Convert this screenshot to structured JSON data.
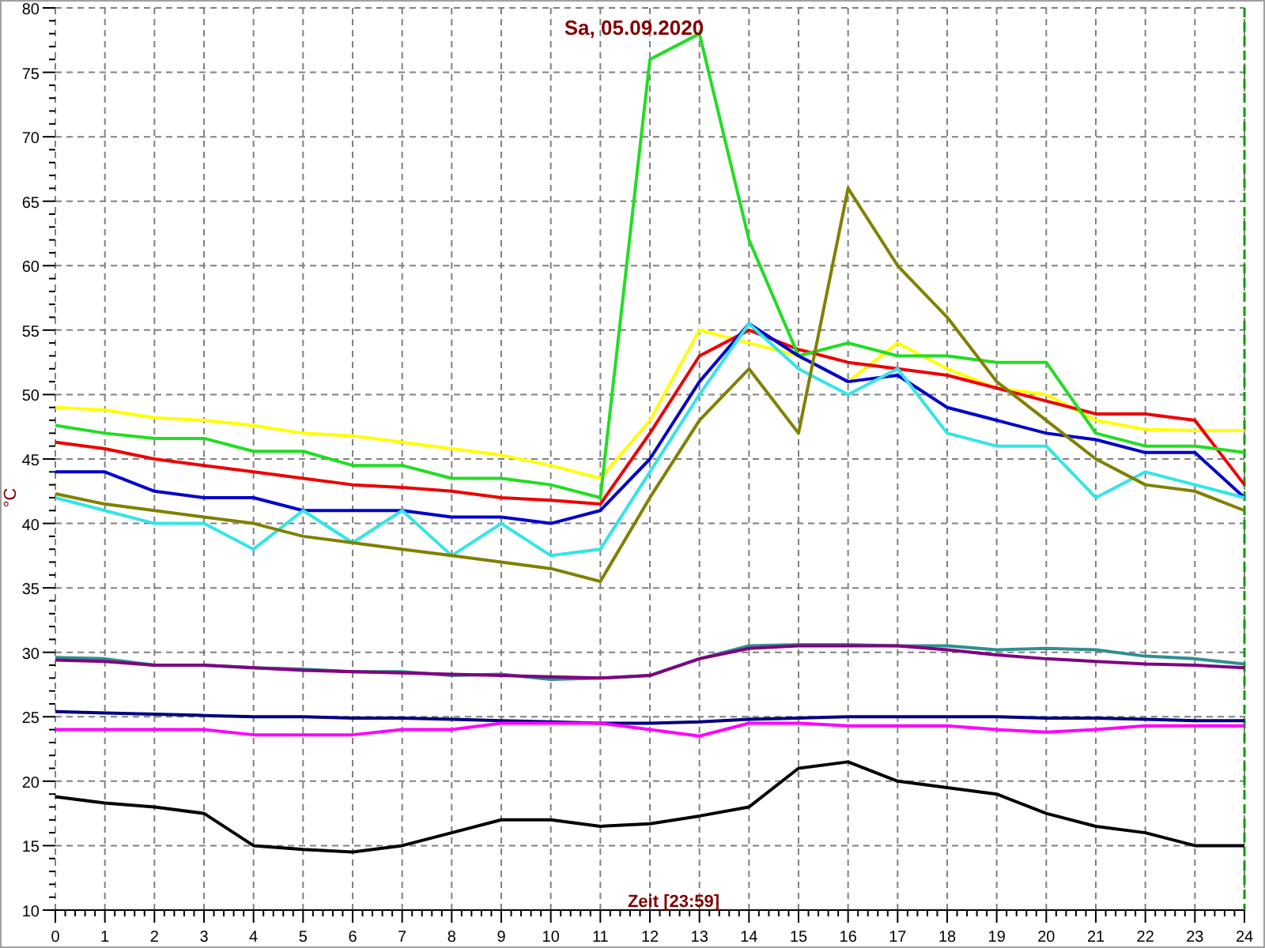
{
  "chart_data": {
    "type": "line",
    "title": "Sa, 05.09.2020",
    "xlabel": "Zeit [23:59]",
    "ylabel": "°C",
    "x": [
      0,
      1,
      2,
      3,
      4,
      5,
      6,
      7,
      8,
      9,
      10,
      11,
      12,
      13,
      14,
      15,
      16,
      17,
      18,
      19,
      20,
      21,
      22,
      23,
      24
    ],
    "xlim": [
      0,
      24
    ],
    "ylim": [
      10,
      80
    ],
    "xticks": [
      0,
      1,
      2,
      3,
      4,
      5,
      6,
      7,
      8,
      9,
      10,
      11,
      12,
      13,
      14,
      15,
      16,
      17,
      18,
      19,
      20,
      21,
      22,
      23,
      24
    ],
    "yticks": [
      10,
      15,
      20,
      25,
      30,
      35,
      40,
      45,
      50,
      55,
      60,
      65,
      70,
      75,
      80
    ],
    "series": [
      {
        "color": "#ffff00",
        "values": [
          49,
          48.8,
          48.2,
          48,
          47.6,
          47,
          46.8,
          46.3,
          45.8,
          45.3,
          44.5,
          43.5,
          48,
          55,
          54,
          53,
          51,
          54,
          52,
          50.5,
          50,
          48,
          47.3,
          47.2,
          47.2
        ]
      },
      {
        "color": "#ee0000",
        "values": [
          46.3,
          45.8,
          45,
          44.5,
          44,
          43.5,
          43,
          42.8,
          42.5,
          42,
          41.8,
          41.5,
          47,
          53,
          55,
          53.5,
          52.5,
          52,
          51.5,
          50.5,
          49.5,
          48.5,
          48.5,
          48,
          43
        ]
      },
      {
        "color": "#22dd22",
        "values": [
          47.6,
          47,
          46.6,
          46.6,
          45.6,
          45.6,
          44.5,
          44.5,
          43.5,
          43.5,
          43,
          42,
          76,
          78,
          62,
          53,
          54,
          53,
          53,
          52.5,
          52.5,
          47,
          46,
          46,
          45.5
        ]
      },
      {
        "color": "#0000cc",
        "values": [
          44,
          44,
          42.5,
          42,
          42,
          41,
          41,
          41,
          40.5,
          40.5,
          40,
          41,
          45,
          51,
          55.5,
          53,
          51,
          51.5,
          49,
          48,
          47,
          46.5,
          45.5,
          45.5,
          42
        ]
      },
      {
        "color": "#33e5e5",
        "values": [
          42,
          41,
          40,
          40,
          38,
          41,
          38.5,
          41,
          37.5,
          40,
          37.5,
          38,
          44,
          50,
          55.5,
          52,
          50,
          52,
          47,
          46,
          46,
          42,
          44,
          43,
          42
        ]
      },
      {
        "color": "#808000",
        "values": [
          42.3,
          41.5,
          41,
          40.5,
          40,
          39,
          38.5,
          38,
          37.5,
          37,
          36.5,
          35.5,
          42,
          48,
          52,
          47,
          66,
          60,
          56,
          51,
          48,
          45,
          43,
          42.5,
          41
        ]
      },
      {
        "color": "#2f8f8f",
        "values": [
          29.6,
          29.5,
          29,
          29,
          28.8,
          28.7,
          28.5,
          28.5,
          28.2,
          28.3,
          27.9,
          28,
          28.2,
          29.5,
          30.5,
          30.6,
          30.6,
          30.5,
          30.5,
          30.2,
          30.3,
          30.2,
          29.7,
          29.5,
          29.1
        ]
      },
      {
        "color": "#800080",
        "values": [
          29.4,
          29.3,
          29,
          29,
          28.8,
          28.6,
          28.5,
          28.4,
          28.3,
          28.2,
          28.1,
          28,
          28.2,
          29.5,
          30.3,
          30.5,
          30.5,
          30.5,
          30.2,
          29.8,
          29.5,
          29.3,
          29.1,
          29,
          28.8
        ]
      },
      {
        "color": "#000080",
        "values": [
          25.4,
          25.3,
          25.2,
          25.1,
          25,
          25,
          24.9,
          24.9,
          24.8,
          24.7,
          24.6,
          24.5,
          24.5,
          24.6,
          24.8,
          24.9,
          25,
          25,
          25,
          25,
          24.9,
          24.9,
          24.8,
          24.7,
          24.7
        ]
      },
      {
        "color": "#ff00ff",
        "values": [
          24,
          24,
          24,
          24,
          23.6,
          23.6,
          23.6,
          24,
          24,
          24.5,
          24.5,
          24.5,
          24,
          23.5,
          24.5,
          24.5,
          24.3,
          24.3,
          24.3,
          24,
          23.8,
          24,
          24.3,
          24.3,
          24.3
        ]
      },
      {
        "color": "#000000",
        "values": [
          18.8,
          18.3,
          18,
          17.5,
          15,
          14.7,
          14.5,
          15,
          16,
          17,
          17,
          16.5,
          16.7,
          17.3,
          18,
          21,
          21.5,
          20,
          19.5,
          19,
          17.5,
          16.5,
          16,
          15,
          15
        ]
      }
    ],
    "grid": true
  }
}
